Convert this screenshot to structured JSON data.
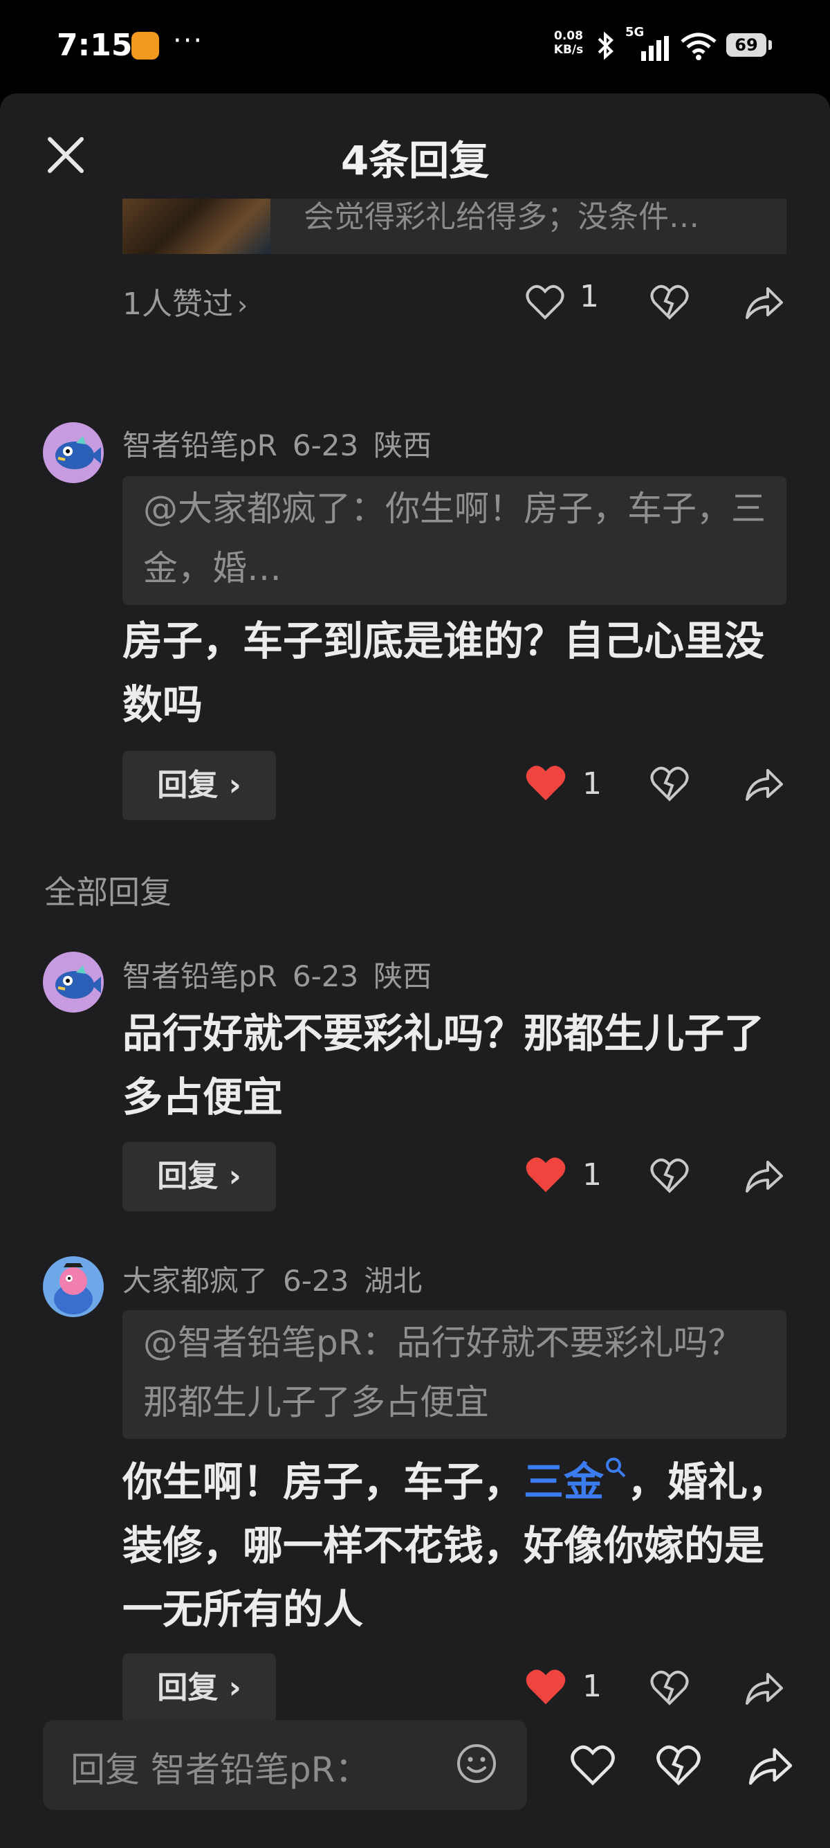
{
  "status_bar": {
    "time": "7:15",
    "dots": "···",
    "net_speed_value": "0.08",
    "net_speed_unit": "KB/s",
    "network": "5G",
    "battery": "69"
  },
  "header": {
    "title": "4条回复",
    "close_icon": "close-icon"
  },
  "previous_comment": {
    "preview_text": "会觉得彩礼给得多；没条件…",
    "likes_summary": "1人赞过",
    "like_count": "1"
  },
  "main_comment": {
    "author": "智者铅笔pR",
    "date": "6-23",
    "location": "陕西",
    "quote": "@大家都疯了：你生啊！房子，车子，三金，婚…",
    "text": "房子，车子到底是谁的？自己心里没数吗",
    "reply_label": "回复",
    "like_count": "1",
    "liked": true
  },
  "section_label": "全部回复",
  "replies": [
    {
      "author": "智者铅笔pR",
      "date": "6-23",
      "location": "陕西",
      "text": "品行好就不要彩礼吗？那都生儿子了多占便宜",
      "reply_label": "回复",
      "like_count": "1",
      "liked": true
    },
    {
      "author": "大家都疯了",
      "date": "6-23",
      "location": "湖北",
      "quote": "@智者铅笔pR：品行好就不要彩礼吗？那都生儿子了多占便宜",
      "text_before": "你生啊！房子，车子，",
      "link_text": "三金",
      "text_after": "，婚礼，装修，哪一样不花钱，好像你嫁的是一无所有的人",
      "reply_label": "回复",
      "like_count": "1",
      "liked": true
    }
  ],
  "bottom_bar": {
    "input_placeholder": "回复 智者铅笔pR："
  },
  "colors": {
    "background": "#1e1e20",
    "card": "#2d2d2f",
    "like_red": "#f0453f",
    "link_blue": "#3b7cf0"
  }
}
